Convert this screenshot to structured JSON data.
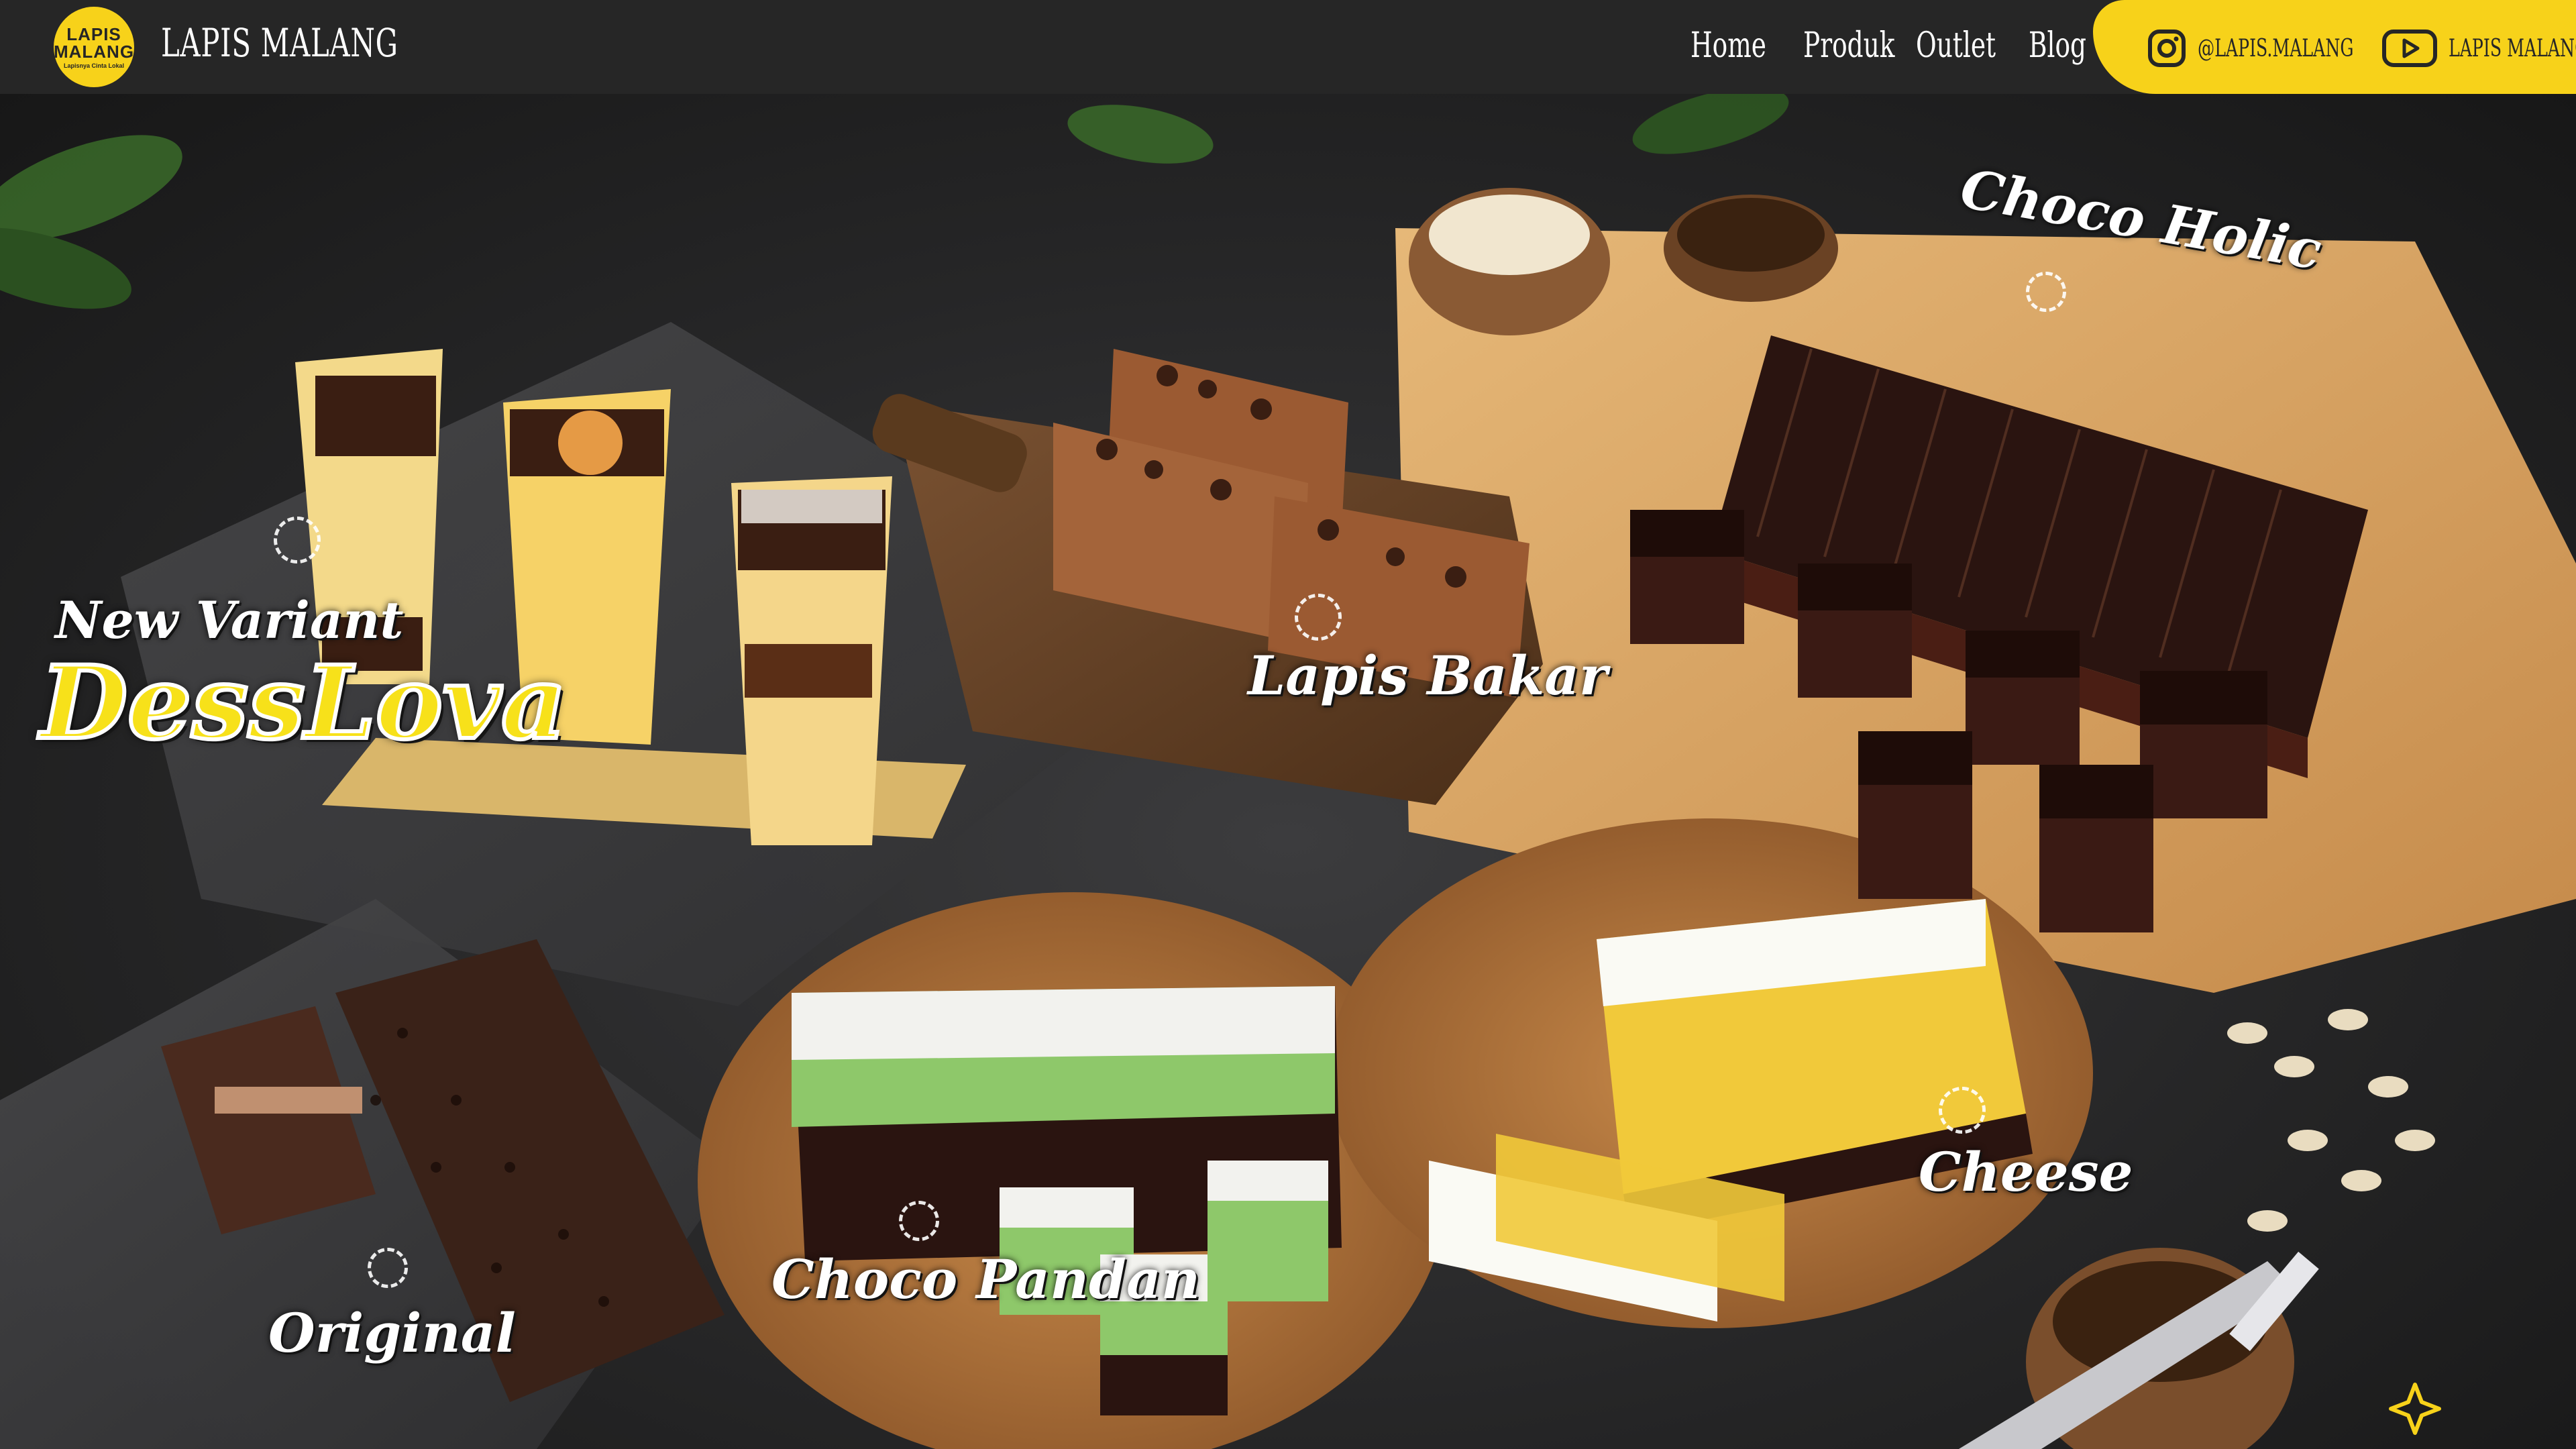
{
  "header": {
    "logo": {
      "line1": "LAPIS",
      "line2": "MALANG",
      "tagline": "Lapisnya Cinta Lokal"
    },
    "brand_name": "LAPIS MALANG",
    "nav": [
      {
        "label": "Home"
      },
      {
        "label": "Produk"
      },
      {
        "label": "Outlet"
      },
      {
        "label": "Blog"
      }
    ],
    "social": {
      "instagram": {
        "icon": "instagram-icon",
        "label": "@LAPIS.MALANG"
      },
      "youtube": {
        "icon": "youtube-icon",
        "label": "LAPIS MALANG"
      }
    }
  },
  "hero": {
    "new_variant_label": "New Variant",
    "new_variant_name": "DessLova",
    "products": [
      {
        "label": "Lapis Bakar"
      },
      {
        "label": "Choco Holic"
      },
      {
        "label": "Original"
      },
      {
        "label": "Choco Pandan"
      },
      {
        "label": "Cheese"
      }
    ]
  },
  "colors": {
    "nav_bg": "#262626",
    "brand_yellow": "#f7d21a",
    "text_white": "#ffffff"
  }
}
